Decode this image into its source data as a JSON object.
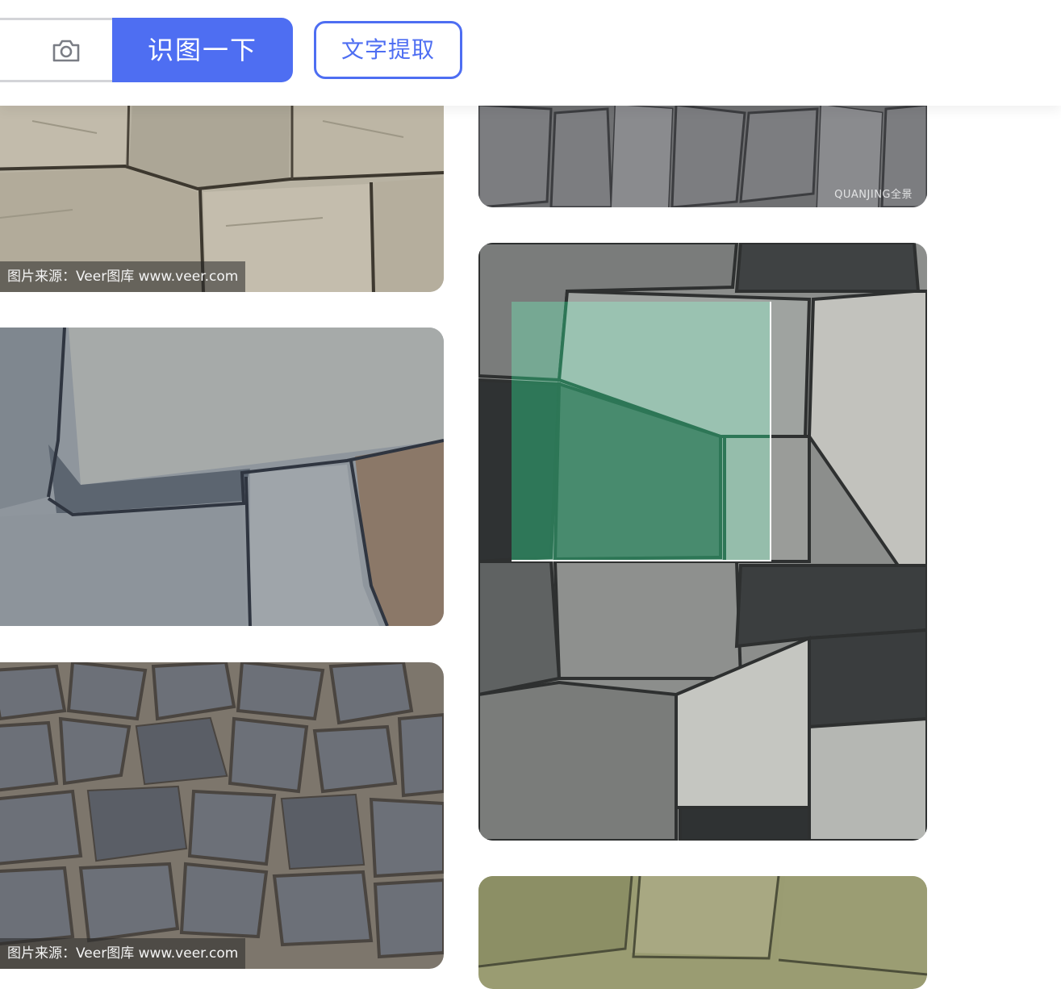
{
  "toolbar": {
    "search_button_label": "识图一下",
    "ocr_button_label": "文字提取"
  },
  "results": {
    "left_column": [
      {
        "source_label": "图片来源：Veer图库 www.veer.com"
      },
      {
        "source_label": ""
      },
      {
        "source_label": "图片来源：Veer图库 www.veer.com"
      }
    ],
    "right_column": [
      {
        "watermark": "QUANJING全景"
      },
      {
        "watermark": ""
      },
      {
        "watermark": ""
      }
    ]
  },
  "colors": {
    "accent": "#4e6ef2",
    "selection_tint": "#76ecb9"
  }
}
